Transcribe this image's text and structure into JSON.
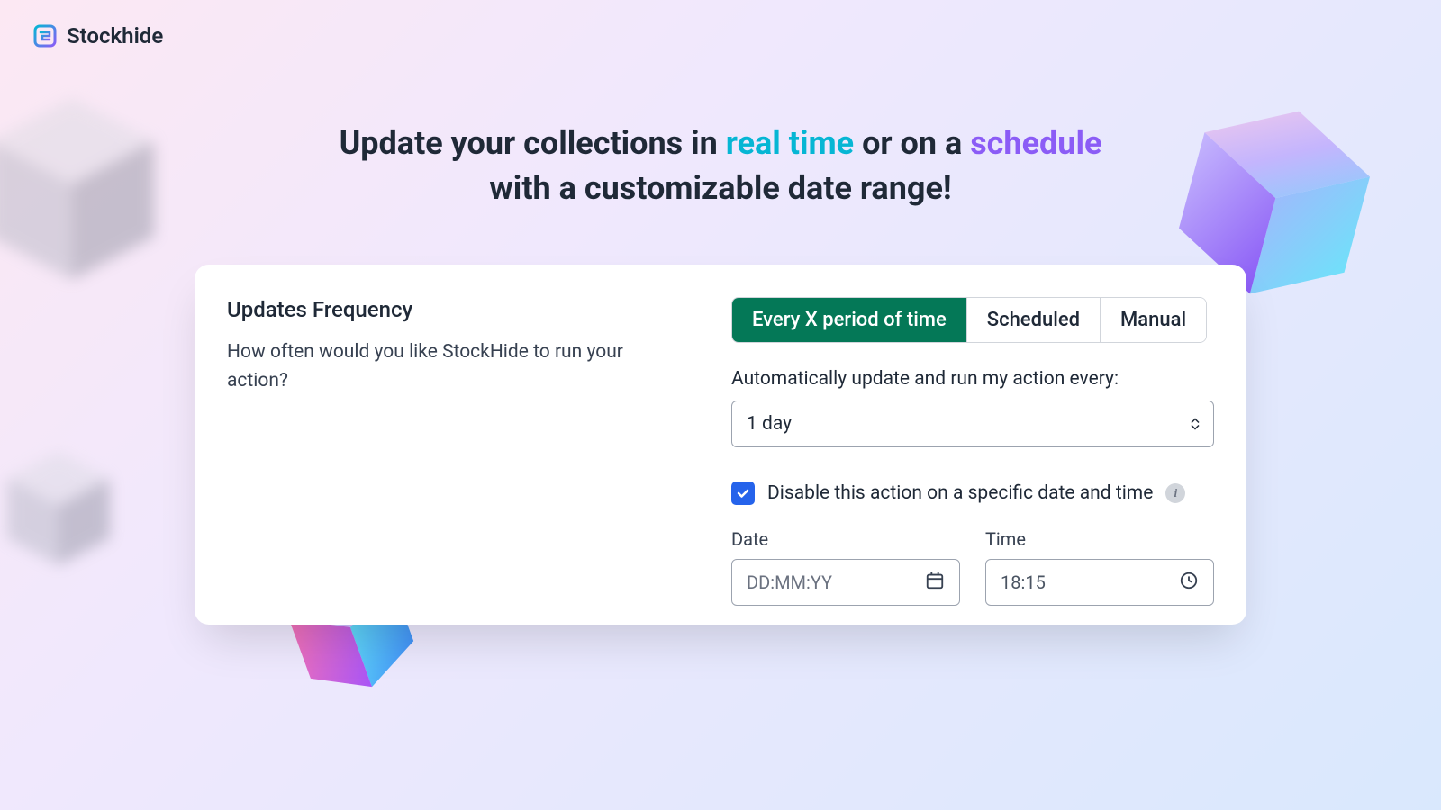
{
  "brand": {
    "name": "Stockhide"
  },
  "headline": {
    "part1": "Update your collections in ",
    "accent1": "real time",
    "part2": " or on a ",
    "accent2": "schedule",
    "part3": " with a customizable date range!"
  },
  "card": {
    "title": "Updates Frequency",
    "subtitle": "How often would you like StockHide to run your action?"
  },
  "tabs": {
    "option1": "Every X period of time",
    "option2": "Scheduled",
    "option3": "Manual"
  },
  "form": {
    "autoUpdateLabel": "Automatically update and run my action every:",
    "periodValue": "1 day",
    "disableCheckboxLabel": "Disable this action on a specific date and time",
    "dateLabel": "Date",
    "datePlaceholder": "DD:MM:YY",
    "timeLabel": "Time",
    "timeValue": "18:15"
  }
}
